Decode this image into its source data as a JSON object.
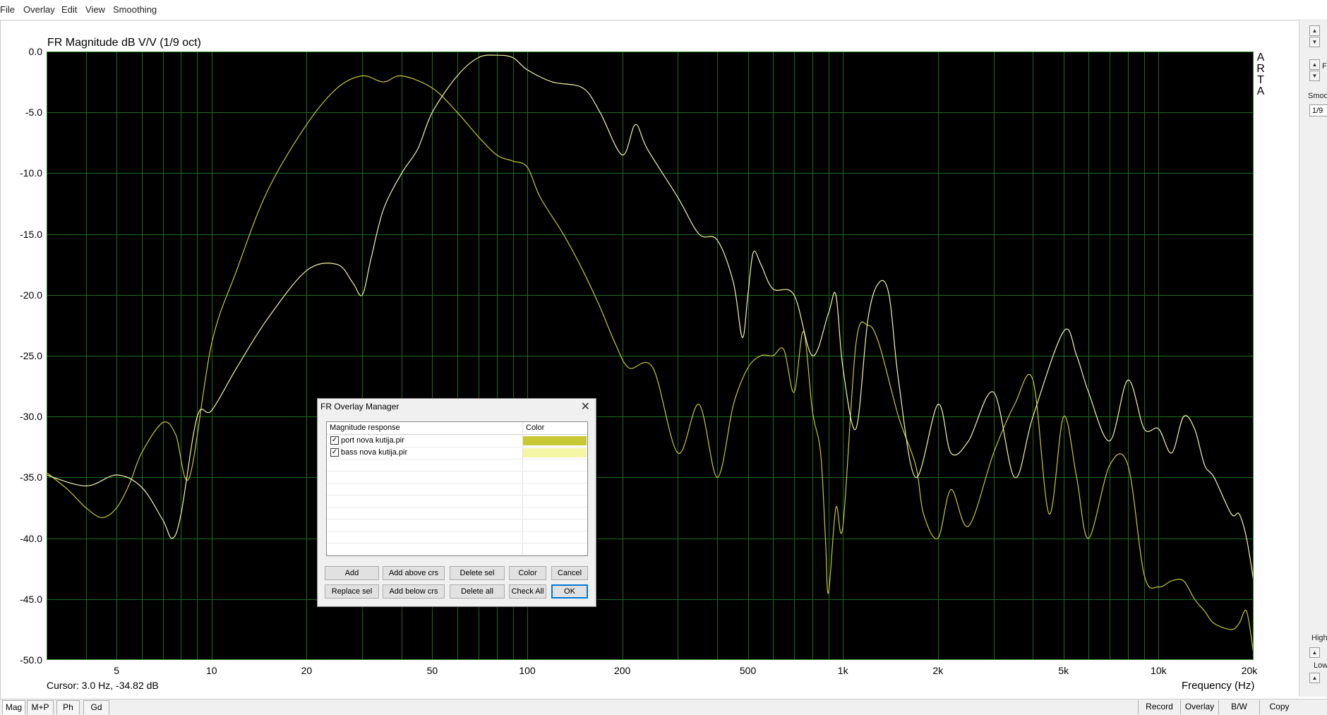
{
  "menu": [
    "File",
    "Overlay",
    "Edit",
    "View",
    "Smoothing"
  ],
  "plot": {
    "title": "FR Magnitude dB V/V (1/9 oct)",
    "xaxis_title": "Frequency (Hz)",
    "cursor": "Cursor: 3.0 Hz, -34.82 dB",
    "brand_letters": [
      "A",
      "R",
      "T",
      "A"
    ],
    "y_tick_labels": [
      "0.0",
      "-5.0",
      "-10.0",
      "-15.0",
      "-20.0",
      "-25.0",
      "-30.0",
      "-35.0",
      "-40.0",
      "-45.0",
      "-50.0"
    ],
    "x_tick_labels": [
      {
        "f": 5,
        "label": "5"
      },
      {
        "f": 10,
        "label": "10"
      },
      {
        "f": 20,
        "label": "20"
      },
      {
        "f": 50,
        "label": "50"
      },
      {
        "f": 100,
        "label": "100"
      },
      {
        "f": 200,
        "label": "200"
      },
      {
        "f": 500,
        "label": "500"
      },
      {
        "f": 1000,
        "label": "1k"
      },
      {
        "f": 2000,
        "label": "2k"
      },
      {
        "f": 5000,
        "label": "5k"
      },
      {
        "f": 10000,
        "label": "10k"
      },
      {
        "f": 20000,
        "label": "20k"
      }
    ],
    "colors": {
      "background": "#000000",
      "grid": "#1f6b1f",
      "port": "#c8c832",
      "bass": "#f5f5a6"
    }
  },
  "chart_data": {
    "type": "line",
    "x_scale": "log",
    "xlim": [
      3,
      20000
    ],
    "ylim": [
      -50,
      0
    ],
    "grid": true,
    "series": [
      {
        "name": "port nova kutija.pir",
        "color": "#c8c832",
        "x": [
          3,
          3.5,
          4,
          4.5,
          5,
          5.5,
          6,
          7,
          7.7,
          8.5,
          10,
          12,
          15,
          20,
          25,
          30,
          35,
          40,
          50,
          60,
          70,
          80,
          90,
          100,
          110,
          130,
          150,
          170,
          190,
          210,
          250,
          300,
          350,
          400,
          450,
          500,
          550,
          600,
          650,
          700,
          750,
          800,
          850,
          880,
          900,
          950,
          1000,
          1100,
          1200,
          1300,
          1500,
          1700,
          1800,
          2000,
          2200,
          2500,
          3000,
          3500,
          4000,
          4500,
          5000,
          5500,
          6000,
          7000,
          8000,
          9000,
          10000,
          11000,
          12000,
          13000,
          14000,
          15000,
          17000,
          18000,
          19000,
          20000
        ],
        "y": [
          -34.6,
          -36,
          -37.5,
          -38.3,
          -37.5,
          -35.5,
          -33,
          -30.5,
          -31.5,
          -35,
          -24,
          -18,
          -11.5,
          -6,
          -3,
          -2,
          -2.5,
          -2,
          -3,
          -5,
          -7,
          -8.5,
          -9,
          -9.5,
          -12,
          -15,
          -18,
          -21,
          -24,
          -26,
          -26,
          -33,
          -29,
          -35,
          -29,
          -26,
          -25,
          -25,
          -24.5,
          -28,
          -23,
          -29.5,
          -33,
          -40,
          -44.5,
          -37.5,
          -39,
          -24,
          -22.5,
          -24,
          -30,
          -34,
          -38,
          -40,
          -36,
          -39,
          -33,
          -29,
          -27,
          -38,
          -30,
          -35,
          -40,
          -34,
          -34,
          -43,
          -44,
          -43.5,
          -43.5,
          -45,
          -46,
          -47,
          -47.5,
          -47,
          -46,
          -49.5
        ]
      },
      {
        "name": "bass nova kutija.pir",
        "color": "#f5f5a6",
        "x": [
          3,
          4,
          5,
          6,
          7,
          7.5,
          8,
          9,
          10,
          12,
          15,
          20,
          25,
          28,
          30,
          32,
          35,
          40,
          45,
          50,
          60,
          70,
          80,
          90,
          100,
          120,
          150,
          170,
          200,
          220,
          240,
          300,
          350,
          400,
          450,
          480,
          500,
          520,
          550,
          600,
          700,
          800,
          900,
          950,
          1000,
          1100,
          1200,
          1300,
          1400,
          1500,
          1700,
          2000,
          2200,
          2500,
          3000,
          3500,
          4000,
          5000,
          5500,
          6000,
          7000,
          8000,
          9000,
          10000,
          11000,
          12000,
          13000,
          14000,
          15000,
          17000,
          18000,
          19000,
          20000
        ],
        "y": [
          -34.8,
          -35.7,
          -34.8,
          -35.8,
          -38.5,
          -40,
          -38,
          -30,
          -29.5,
          -26,
          -22,
          -18,
          -17.5,
          -19,
          -20,
          -17,
          -13,
          -10,
          -8,
          -5,
          -2,
          -0.5,
          -0.3,
          -0.5,
          -1.5,
          -2.5,
          -3,
          -5,
          -8.5,
          -6,
          -8,
          -12,
          -15,
          -15.5,
          -19,
          -23.5,
          -20,
          -16.5,
          -17.5,
          -19.5,
          -20,
          -25,
          -21.5,
          -20,
          -26,
          -31,
          -22,
          -19,
          -20,
          -27,
          -35,
          -29,
          -33,
          -32,
          -28,
          -35,
          -30,
          -23,
          -25,
          -28,
          -32,
          -27,
          -31,
          -31,
          -33,
          -30,
          -31,
          -34,
          -35,
          -38,
          -38,
          -40,
          -43.5
        ]
      }
    ]
  },
  "dialog": {
    "title": "FR Overlay Manager",
    "col_response": "Magnitude response",
    "col_color": "Color",
    "rows": [
      {
        "label": "port nova kutija.pir",
        "checked": true,
        "color": "#c8c832"
      },
      {
        "label": "bass nova kutija.pir",
        "checked": true,
        "color": "#f5f5a6"
      }
    ],
    "buttons_row1": [
      "Add",
      "Add above crs",
      "Delete sel",
      "Color",
      "Cancel"
    ],
    "buttons_row2": [
      "Replace sel",
      "Add below crs",
      "Delete all",
      "Check All",
      "OK"
    ]
  },
  "bottom_tabs": [
    "Mag",
    "M+P",
    "Ph",
    "Gd"
  ],
  "bottom_buttons": [
    "Record",
    "Overlay",
    "B/W",
    "Copy"
  ],
  "right_panel": {
    "smoothing_label": "Smoo",
    "smoothing_value": "1/9",
    "high_label": "High",
    "low_label": "Low",
    "letter_label": "F"
  }
}
